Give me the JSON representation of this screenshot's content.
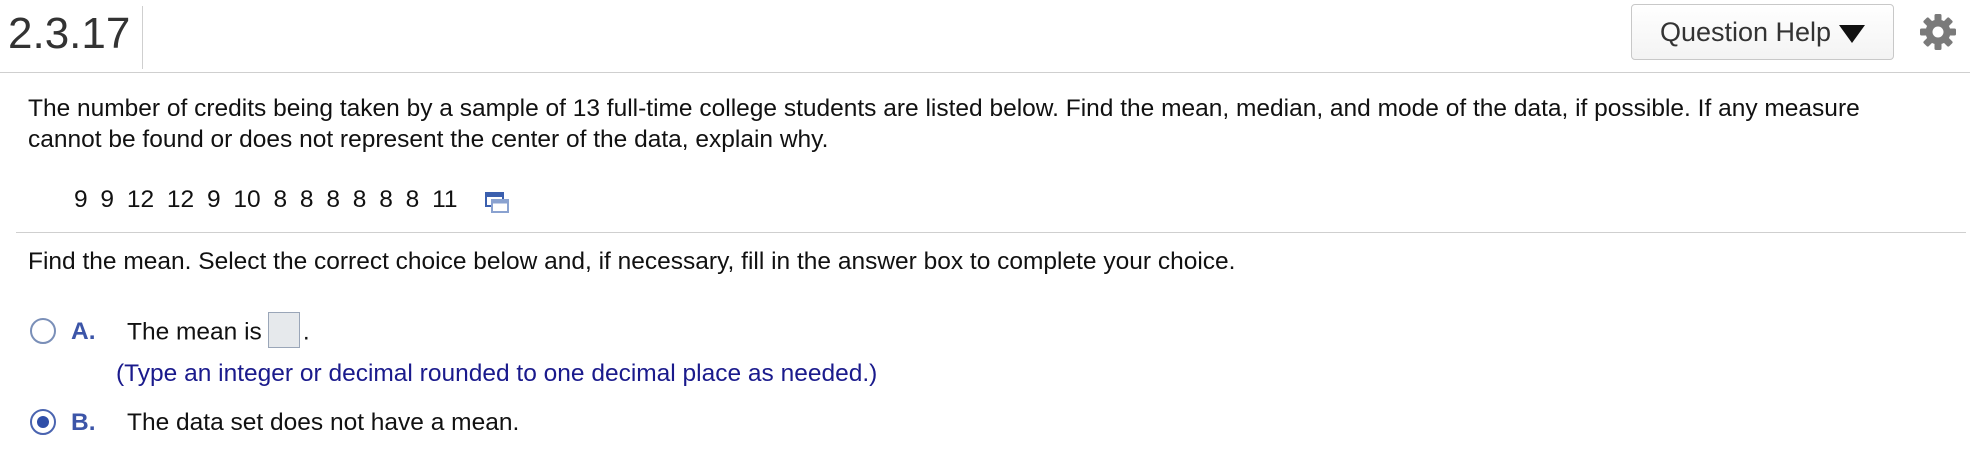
{
  "header": {
    "question_number": "2.3.17",
    "help_button_label": "Question Help"
  },
  "question": {
    "prompt": "The number of credits being taken by a sample of 13 full-time college students are listed below. Find the mean, median, and mode of the data, if possible. If any measure cannot be found or does not represent the center of the data, explain why.",
    "dataset": "9 9 12 12 9 10 8 8 8 8 8 8 11",
    "instruction": "Find the mean. Select the correct choice below and, if necessary, fill in the answer box to complete your choice."
  },
  "choices": [
    {
      "letter": "A.",
      "text_before": "The mean is",
      "text_after": ".",
      "hint": "(Type an integer or decimal rounded to one decimal place as needed.)",
      "selected": false
    },
    {
      "letter": "B.",
      "text": "The data set does not have a mean.",
      "selected": true
    }
  ],
  "colors": {
    "accent": "#3c55a8",
    "hint_text": "#1a1a8c",
    "divider": "#cfcfcf"
  },
  "icons": {
    "help_caret": "caret-down-icon",
    "settings": "gear-icon",
    "copy_data": "copy-data-icon",
    "radio": "radio-icon"
  }
}
